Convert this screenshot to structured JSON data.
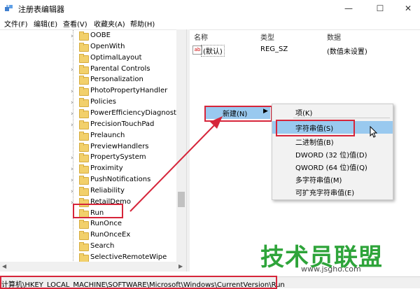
{
  "window": {
    "title": "注册表编辑器",
    "minimize": "—",
    "maximize": "☐",
    "close": "✕"
  },
  "menu": [
    "文件(F)",
    "编辑(E)",
    "查看(V)",
    "收藏夹(A)",
    "帮助(H)"
  ],
  "tree": {
    "items": [
      "OOBE",
      "OpenWith",
      "OptimalLayout",
      "Parental Controls",
      "Personalization",
      "PhotoPropertyHandler",
      "Policies",
      "PowerEfficiencyDiagnostics",
      "PrecisionTouchPad",
      "Prelaunch",
      "PreviewHandlers",
      "PropertySystem",
      "Proximity",
      "PushNotifications",
      "Reliability",
      "RetailDemo",
      "Run",
      "RunOnce",
      "RunOnceEx",
      "Search",
      "SelectiveRemoteWipe"
    ],
    "expandable": [
      true,
      false,
      false,
      true,
      false,
      true,
      true,
      true,
      true,
      false,
      false,
      true,
      true,
      true,
      true,
      true,
      false,
      false,
      false,
      false,
      false
    ],
    "selected": "Run"
  },
  "list": {
    "columns": [
      "名称",
      "类型",
      "数据"
    ],
    "rows": [
      {
        "name": "(默认)",
        "type": "REG_SZ",
        "data": "(数值未设置)",
        "icon": "ab-icon"
      }
    ]
  },
  "context_menu": {
    "new_label": "新建(N)",
    "submenu": [
      "项(K)",
      "字符串值(S)",
      "二进制值(B)",
      "DWORD (32 位)值(D)",
      "QWORD (64 位)值(Q)",
      "多字符串值(M)",
      "可扩充字符串值(E)"
    ],
    "highlighted": "字符串值(S)"
  },
  "status": {
    "path": "计算机\\HKEY_LOCAL_MACHINE\\SOFTWARE\\Microsoft\\Windows\\CurrentVersion\\Run"
  },
  "watermark": {
    "title": "技术员联盟",
    "url": "www.jsgho.com"
  },
  "colors": {
    "highlight": "#99c9ef",
    "annotation": "#d6253a",
    "watermark_green": "#2ea43a",
    "folder": "#f2d06b"
  }
}
